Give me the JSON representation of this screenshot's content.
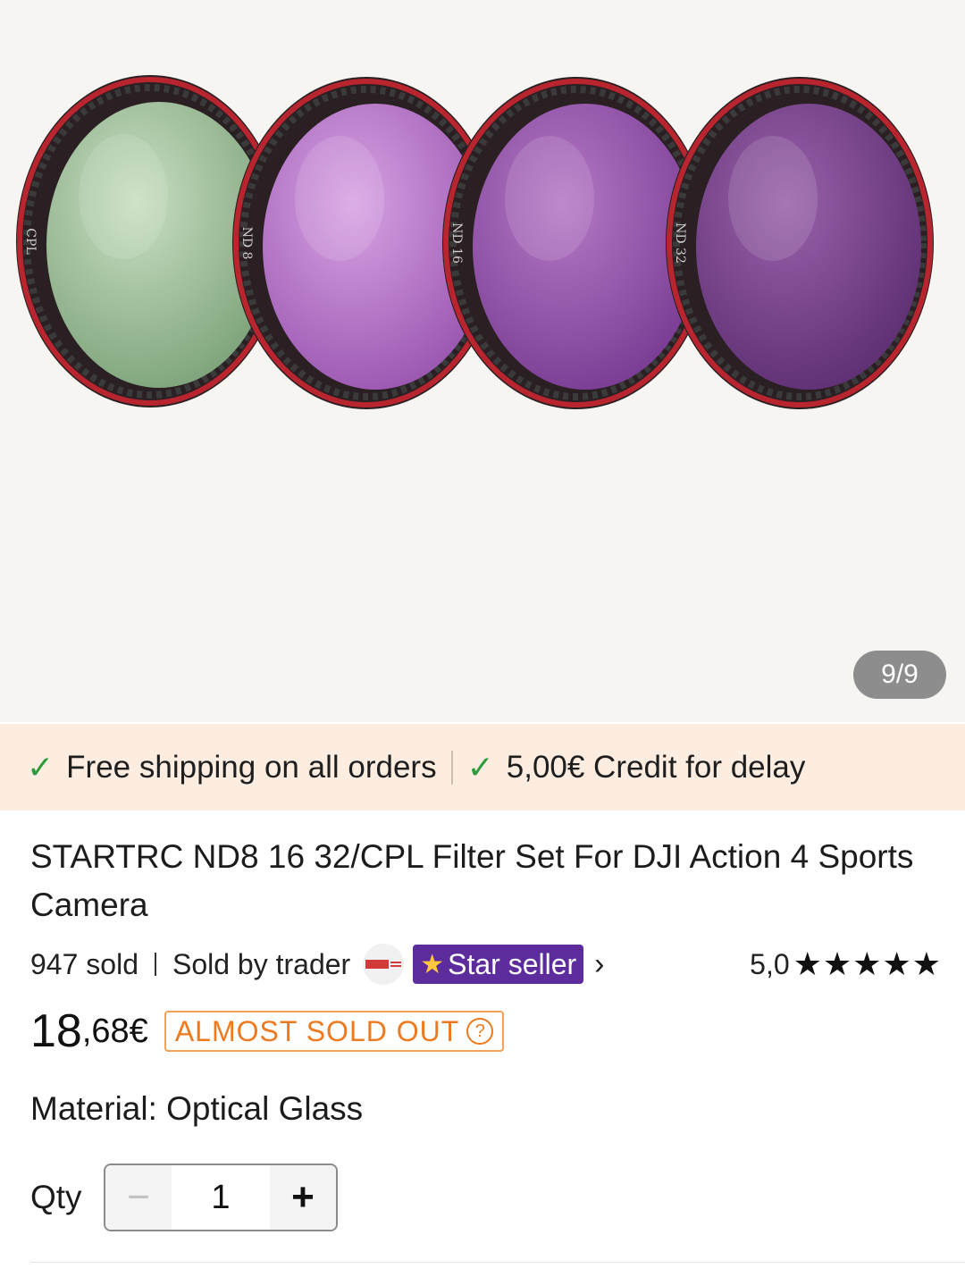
{
  "gallery": {
    "counter": "9/9",
    "filters": [
      {
        "label": "CPL",
        "glass": "#9ec79b"
      },
      {
        "label": "ND 8",
        "glass": "#b77ecb"
      },
      {
        "label": "ND 16",
        "glass": "#9b5fb0"
      },
      {
        "label": "ND 32",
        "glass": "#7f4a94"
      }
    ]
  },
  "promo": {
    "shipping": "Free shipping on all orders",
    "credit": "5,00€ Credit for delay"
  },
  "product": {
    "title": "STARTRC ND8 16 32/CPL Filter Set For DJI Action 4 Sports Camera",
    "sold": "947 sold",
    "sold_by": "Sold by trader",
    "star_seller": "Star seller",
    "rating": "5,0",
    "stars": "★★★★★",
    "price_int": "18",
    "price_dec": ",68€",
    "badge": "ALMOST SOLD OUT",
    "material": "Material: Optical Glass",
    "qty_label": "Qty",
    "qty_value": "1"
  },
  "colors": {
    "promo_bg": "#fcede0",
    "check": "#2e9a3c",
    "star_seller_bg": "#5c2c9c",
    "badge": "#ee7a20"
  }
}
